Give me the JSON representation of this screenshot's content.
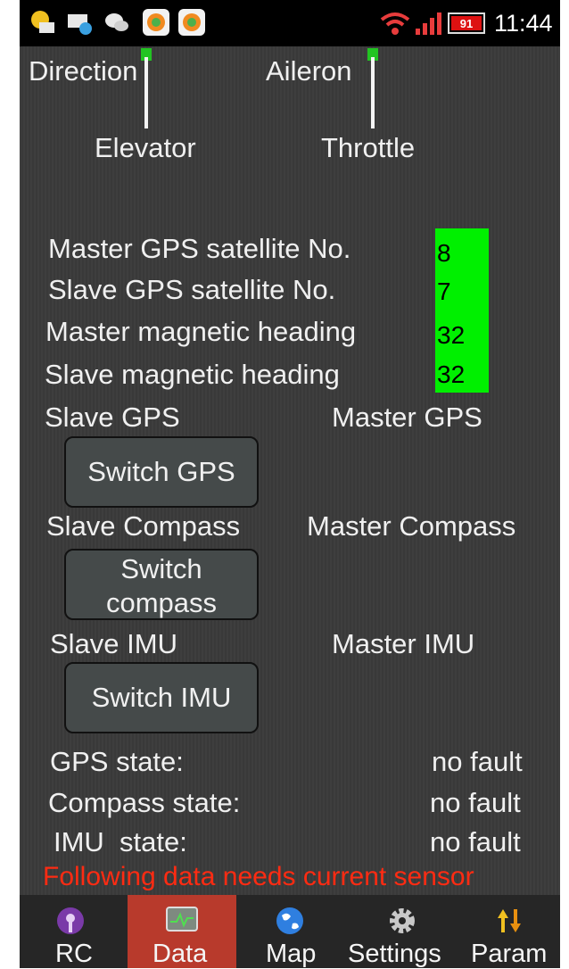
{
  "status_bar": {
    "clock": "11:44",
    "battery": "91",
    "icons": [
      "qq-mail-icon",
      "message-icon",
      "wechat-icon",
      "app-icon",
      "app-icon",
      "wifi-icon",
      "signal-icon",
      "battery-icon"
    ]
  },
  "sticks": {
    "left_top": "Direction",
    "left_bottom": "Elevator",
    "right_top": "Aileron",
    "right_bottom": "Throttle"
  },
  "readings": [
    {
      "label": "Master GPS satellite No.",
      "value": "8"
    },
    {
      "label": "Slave GPS satellite No.",
      "value": "7"
    },
    {
      "label": "Master magnetic heading",
      "value": "32"
    },
    {
      "label": "Slave magnetic heading",
      "value": "32"
    }
  ],
  "switches": {
    "gps": {
      "left": "Slave GPS",
      "right": "Master GPS",
      "button": "Switch GPS"
    },
    "compass": {
      "left": "Slave Compass",
      "right": "Master Compass",
      "button_line1": "Switch",
      "button_line2": "compass"
    },
    "imu": {
      "left": "Slave IMU",
      "right": "Master IMU",
      "button": "Switch IMU"
    }
  },
  "states": [
    {
      "label": "GPS state:",
      "value": "no fault"
    },
    {
      "label": "Compass state:",
      "value": "no fault"
    },
    {
      "label": "IMU  state:",
      "value": "no fault"
    }
  ],
  "warning": "Following data needs current sensor",
  "colors": {
    "accent_green": "#00f000",
    "warning_red": "#ff2b12",
    "active_tab": "#b83a2c"
  },
  "tabs": [
    {
      "label": "RC",
      "icon": "radio-icon",
      "active": false
    },
    {
      "label": "Data",
      "icon": "monitor-icon",
      "active": true
    },
    {
      "label": "Map",
      "icon": "globe-icon",
      "active": false
    },
    {
      "label": "Settings",
      "icon": "gear-icon",
      "active": false
    },
    {
      "label": "Param",
      "icon": "arrows-icon",
      "active": false
    }
  ]
}
